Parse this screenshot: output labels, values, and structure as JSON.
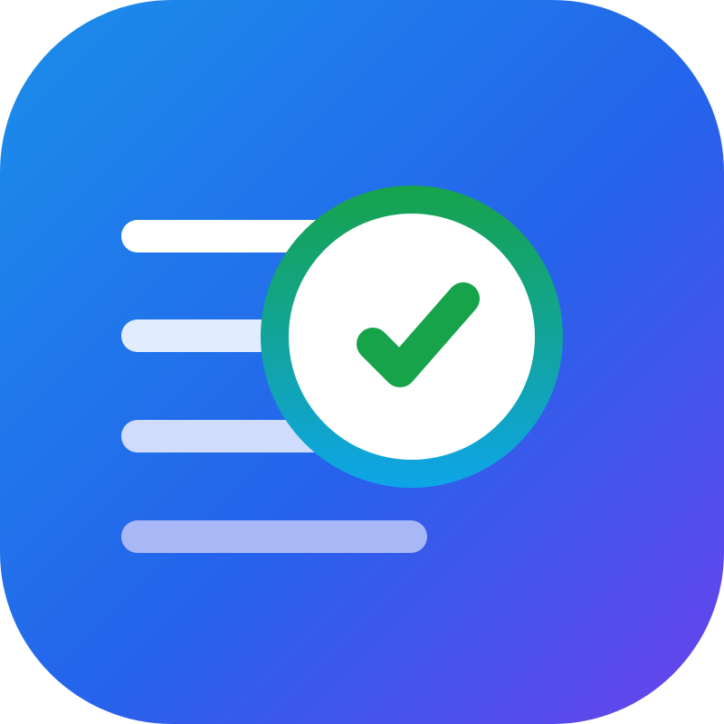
{
  "icon": {
    "name": "checklist-app-icon",
    "colors": {
      "background_gradient_start": "#1a8fea",
      "background_gradient_mid": "#2563eb",
      "background_gradient_end": "#6a42ec",
      "line_1": "#ffffff",
      "line_2": "#e2ecff",
      "line_3": "#cfdcfb",
      "line_4": "#a8b8f6",
      "badge_fill": "#ffffff",
      "badge_ring_top": "#16a34a",
      "badge_ring_bottom": "#0ea5e9",
      "checkmark": "#16a34a"
    },
    "list_lines": [
      {
        "name": "list-line-1",
        "opacity": 1.0
      },
      {
        "name": "list-line-2",
        "opacity": 0.9
      },
      {
        "name": "list-line-3",
        "opacity": 0.78
      },
      {
        "name": "list-line-4",
        "opacity": 0.6
      }
    ],
    "badge_icon": "check-icon"
  }
}
